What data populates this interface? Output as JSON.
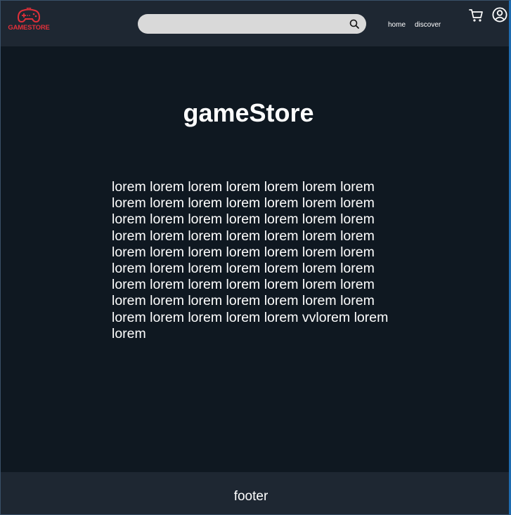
{
  "header": {
    "logo_text": "GAMESTORE",
    "search": {
      "value": "",
      "placeholder": ""
    },
    "nav": {
      "home": "home",
      "discover": "discover"
    }
  },
  "main": {
    "title": "gameStore",
    "body": "lorem lorem lorem lorem lorem lorem lorem lorem lorem lorem lorem lorem lorem lorem lorem lorem lorem lorem lorem lorem lorem lorem lorem lorem lorem lorem lorem lorem lorem lorem lorem lorem lorem lorem lorem lorem lorem lorem lorem lorem lorem lorem lorem lorem lorem lorem lorem lorem lorem lorem lorem lorem lorem lorem lorem lorem lorem lorem lorem lorem lorem vvlorem lorem lorem"
  },
  "footer": {
    "text": "footer"
  },
  "icons": {
    "logo": "gamepad-icon",
    "search": "search-icon",
    "cart": "cart-icon",
    "account": "user-circle-icon"
  },
  "colors": {
    "background": "#0f1821",
    "header": "#1e2732",
    "footer": "#1e2732",
    "search_bg": "#d9d9d9",
    "logo_red": "#e0303a"
  }
}
